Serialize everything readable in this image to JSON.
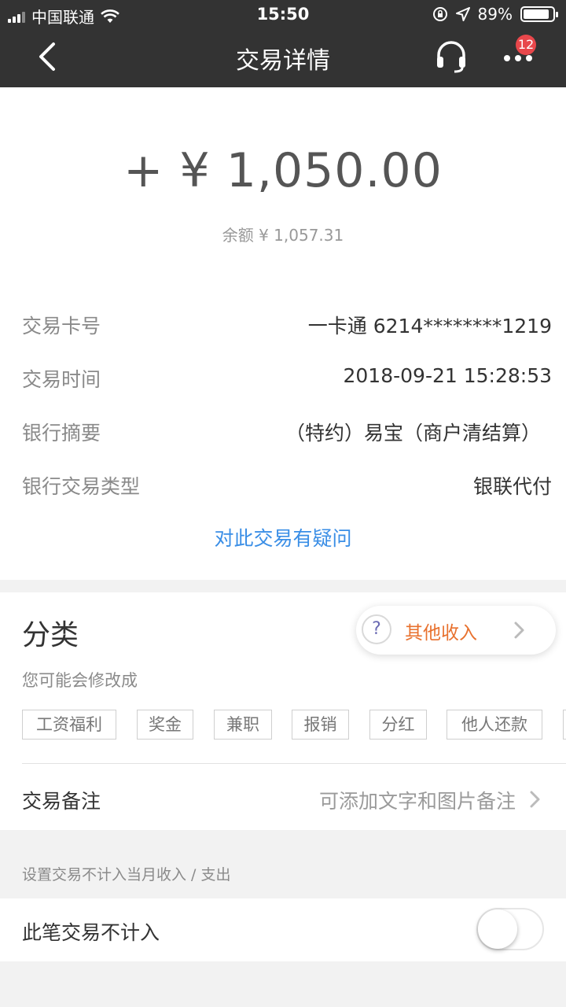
{
  "status_bar": {
    "carrier": "中国联通",
    "time": "15:50",
    "battery_percent": "89%",
    "battery_level": 0.89
  },
  "nav": {
    "title": "交易详情",
    "badge_count": "12",
    "icons": [
      "back-arrow-icon",
      "headset-icon",
      "more-dots-icon"
    ]
  },
  "transaction": {
    "amount": "+ ¥ 1,050.00",
    "balance": "余额 ¥ 1,057.31",
    "details": [
      {
        "label": "交易卡号",
        "value": "一卡通 6214********1219"
      },
      {
        "label": "交易时间",
        "value": "2018-09-21 15:28:53"
      },
      {
        "label": "银行摘要",
        "value": "（特约）易宝（商户清结算）"
      },
      {
        "label": "银行交易类型",
        "value": "银联代付"
      }
    ],
    "query_link": "对此交易有疑问"
  },
  "category": {
    "title": "分类",
    "current": "其他收入",
    "hint": "您可能会修改成",
    "suggestions": [
      "工资福利",
      "奖金",
      "兼职",
      "报销",
      "分红",
      "他人还款"
    ]
  },
  "note": {
    "label": "交易备注",
    "placeholder": "可添加文字和图片备注"
  },
  "exclude": {
    "hint": "设置交易不计入当月收入 / 支出",
    "label": "此笔交易不计入",
    "enabled": false
  },
  "colors": {
    "nav_bg": "#333333",
    "link_blue": "#3a8ee6",
    "category_orange": "#e8712e",
    "badge_red": "#e8474b"
  }
}
